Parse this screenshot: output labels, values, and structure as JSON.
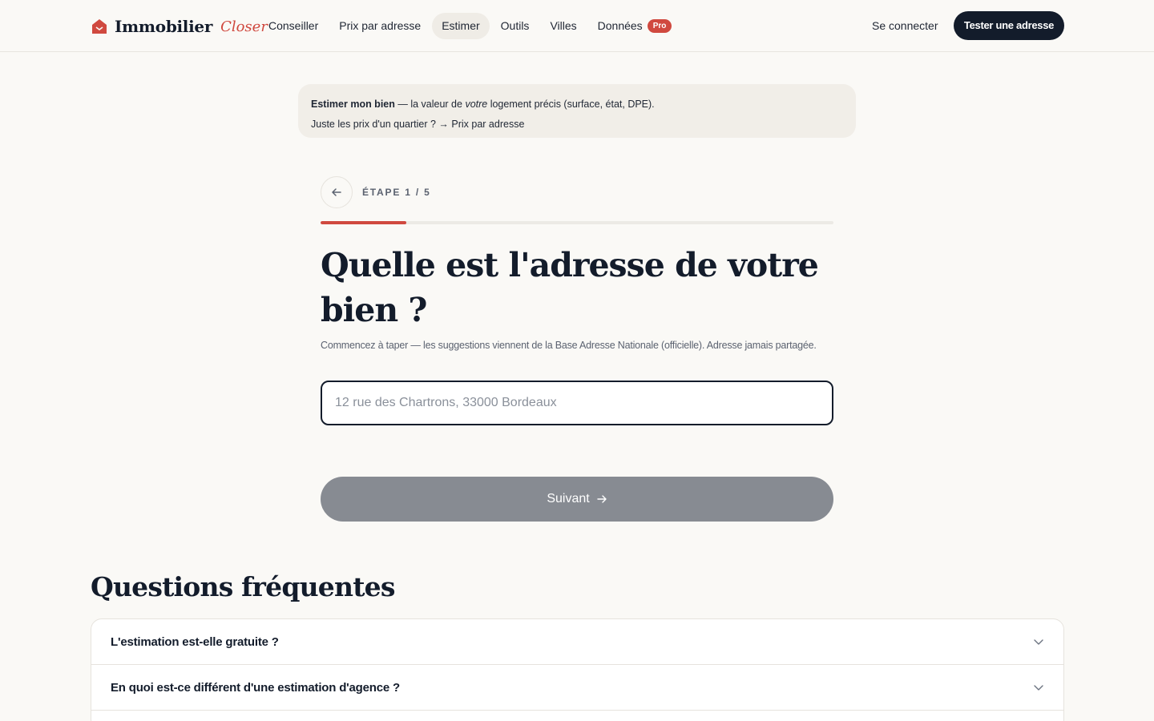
{
  "brand": {
    "name": "Immobilier",
    "script": "Closer",
    "accent": "#d0493f",
    "dark": "#131c2b"
  },
  "nav": {
    "items": [
      {
        "label": "Conseiller"
      },
      {
        "label": "Prix par adresse"
      },
      {
        "label": "Estimer",
        "active": true
      },
      {
        "label": "Outils"
      },
      {
        "label": "Villes"
      },
      {
        "label": "Données",
        "badge": "Pro"
      }
    ],
    "login": "Se connecter",
    "cta": "Tester une adresse"
  },
  "banner": {
    "strong": "Estimer mon bien",
    "line1_a": " — la valeur de ",
    "line1_em": "votre",
    "line1_b": " logement précis (surface, état, DPE).",
    "line2": "Juste les prix d'un quartier ? → Prix par adresse"
  },
  "wizard": {
    "step_label": "ÉTAPE 1 / 5",
    "progress": 0.1667,
    "question": "Quelle est l'adresse de votre bien ?",
    "hint": "Commencez à taper — les suggestions viennent de la Base Adresse Nationale (officielle). Adresse jamais partagée.",
    "input_value": "",
    "input_placeholder": "12 rue des Chartrons, 33000 Bordeaux",
    "next_label": "Suivant"
  },
  "faq": {
    "title": "Questions fréquentes",
    "items": [
      {
        "question": "L'estimation est-elle gratuite ?"
      },
      {
        "question": "En quoi est-ce différent d'une estimation d'agence ?"
      }
    ]
  },
  "icons": {
    "logo": "house-icon",
    "back": "arrow-left-icon",
    "next": "arrow-right-icon",
    "expand": "chevron-down-icon"
  }
}
